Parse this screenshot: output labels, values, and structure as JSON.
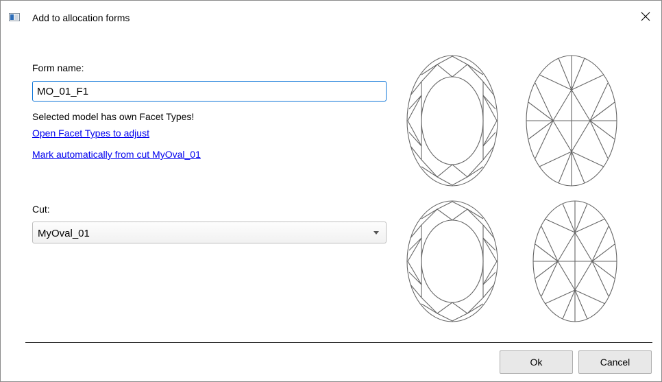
{
  "window": {
    "title": "Add to allocation forms"
  },
  "form": {
    "name_label": "Form name:",
    "name_value": "MO_01_F1",
    "message": "Selected model has own Facet Types!",
    "link_open_facets": "Open Facet Types to adjust",
    "link_mark_auto": "Mark automatically from cut MyOval_01",
    "cut_label": "Cut:",
    "cut_value": "MyOval_01"
  },
  "previews": [
    {
      "name": "form-crown-view"
    },
    {
      "name": "form-pavilion-view"
    },
    {
      "name": "cut-crown-view"
    },
    {
      "name": "cut-pavilion-view"
    }
  ],
  "buttons": {
    "ok": "Ok",
    "cancel": "Cancel"
  },
  "colors": {
    "link": "#0000ee",
    "focus": "#0b74d8",
    "gem_stroke": "#666666"
  }
}
